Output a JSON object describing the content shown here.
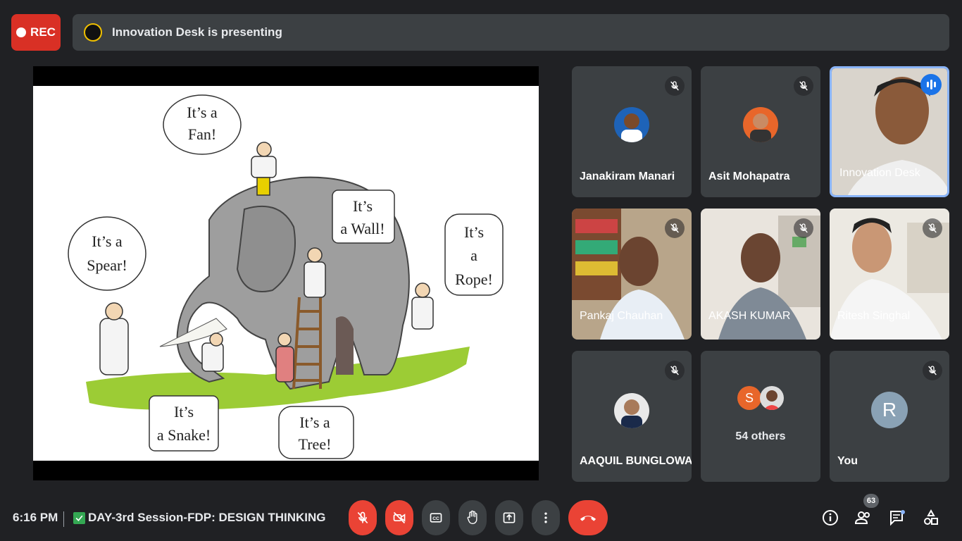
{
  "recording": {
    "label": "REC"
  },
  "presentation_banner": {
    "text": "Innovation Desk is presenting"
  },
  "slide": {
    "bubbles": {
      "fan": [
        "It’s a",
        "Fan!"
      ],
      "wall": [
        "It’s",
        "a Wall!"
      ],
      "spear": [
        "It’s a",
        "Spear!"
      ],
      "rope": [
        "It’s",
        "a",
        "Rope!"
      ],
      "snake": [
        "It’s",
        "a Snake!"
      ],
      "tree": [
        "It’s a",
        "Tree!"
      ]
    }
  },
  "participants": [
    {
      "name": "Janakiram Manari",
      "muted": true
    },
    {
      "name": "Asit Mohapatra",
      "muted": true
    },
    {
      "name": "Innovation Desk",
      "muted": false,
      "speaking": true
    },
    {
      "name": "Pankaj Chauhan",
      "muted": true
    },
    {
      "name": "AKASH KUMAR",
      "muted": true
    },
    {
      "name": "Ritesh Singhal",
      "muted": true
    },
    {
      "name": "AAQUIL BUNGLOWA...",
      "muted": true
    },
    {
      "name": "54 others",
      "avatar_letter": "S"
    },
    {
      "name": "You",
      "muted": true,
      "avatar_letter": "R"
    }
  ],
  "footer": {
    "time": "6:16 PM",
    "meeting_title": "DAY-3rd Session-FDP: DESIGN THINKING",
    "people_count": "63"
  },
  "colors": {
    "red": "#ea4335",
    "tile": "#3c4043",
    "background": "#202124",
    "accent": "#1a73e8"
  },
  "icons": [
    "mic-off-icon",
    "camera-off-icon",
    "captions-icon",
    "raise-hand-icon",
    "present-icon",
    "more-icon",
    "end-call-icon",
    "info-icon",
    "people-icon",
    "chat-icon",
    "activities-icon"
  ]
}
